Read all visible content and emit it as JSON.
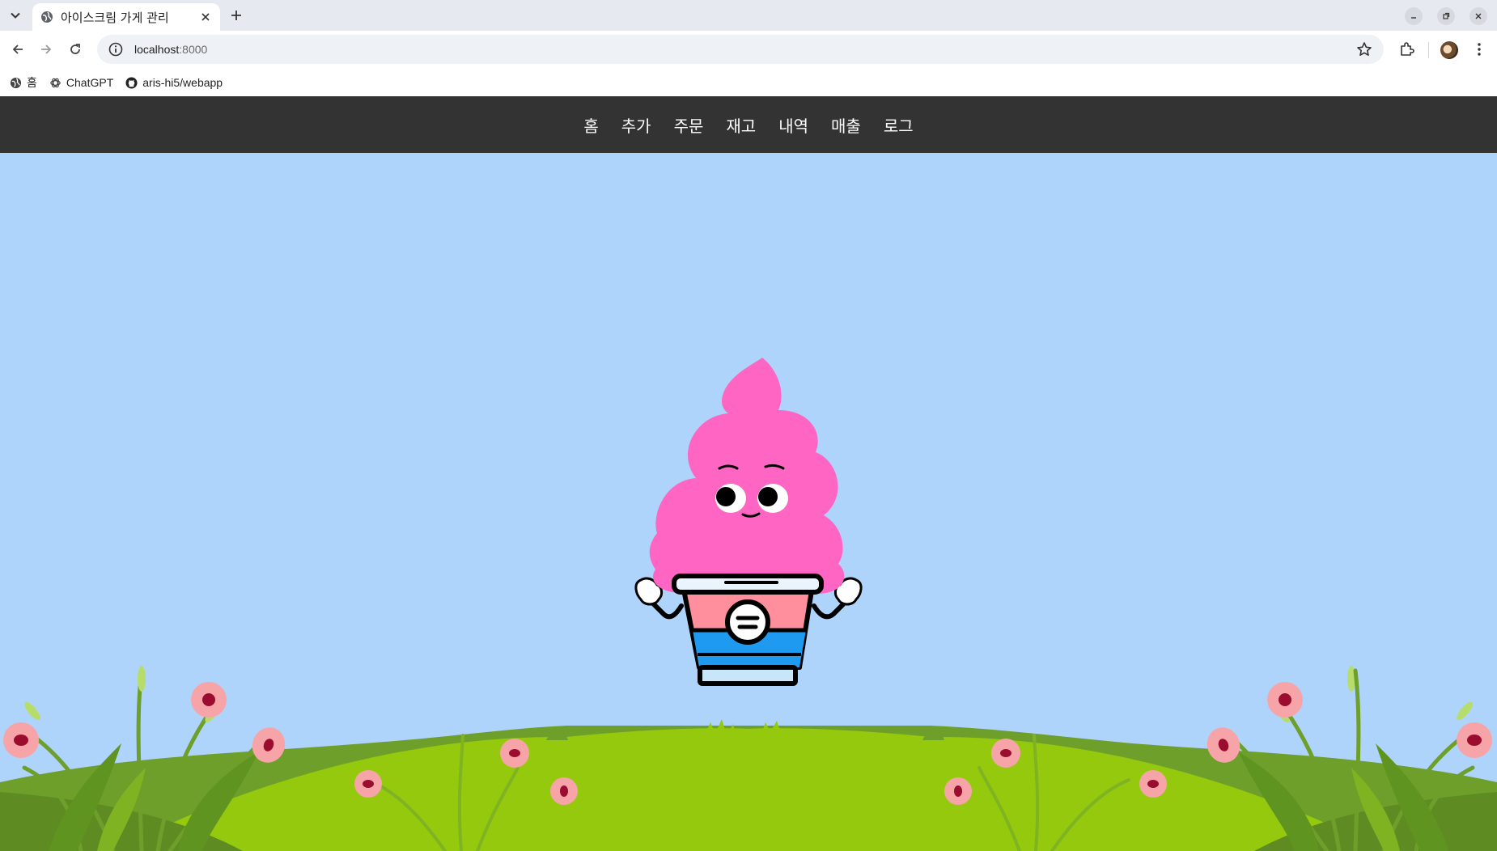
{
  "browser": {
    "tab_title": "아이스크림 가게 관리",
    "url_host": "localhost",
    "url_port": ":8000",
    "bookmarks": [
      {
        "label": "홈",
        "icon": "globe-icon"
      },
      {
        "label": "ChatGPT",
        "icon": "chatgpt-icon"
      },
      {
        "label": "aris-hi5/webapp",
        "icon": "github-icon"
      }
    ]
  },
  "nav": {
    "items": [
      "홈",
      "추가",
      "주문",
      "재고",
      "내역",
      "매출",
      "로그"
    ]
  },
  "colors": {
    "page_bg": "#afd4fc",
    "nav_bg": "#333333",
    "icecream_pink": "#ff66c4",
    "cup_pink": "#ff8f9c",
    "cup_blue": "#1e9af0",
    "grass_dark": "#6e9f2b",
    "grass_light": "#95c90e"
  }
}
